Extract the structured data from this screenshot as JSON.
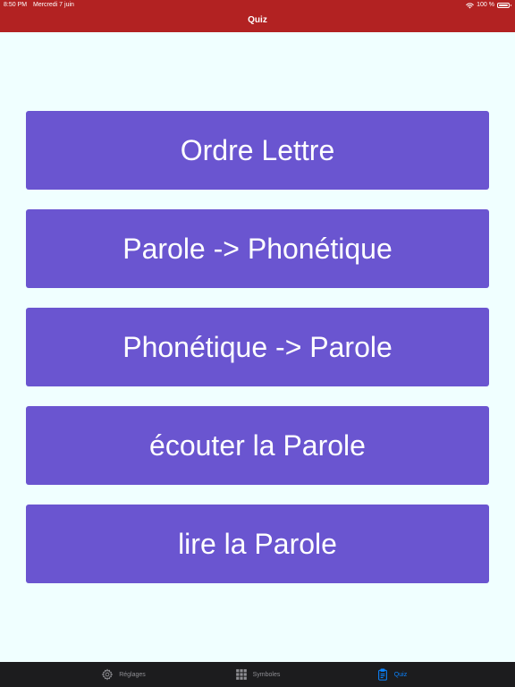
{
  "status_bar": {
    "time": "8:50 PM",
    "date": "Mercredi 7 juin",
    "battery": "100 %",
    "battery_level": 1.0
  },
  "header": {
    "title": "Quiz",
    "background_color": "#b22222"
  },
  "quiz_buttons": [
    {
      "label": "Ordre Lettre"
    },
    {
      "label": "Parole -> Phonétique"
    },
    {
      "label": "Phonétique -> Parole"
    },
    {
      "label": "écouter la Parole"
    },
    {
      "label": "lire la Parole"
    }
  ],
  "button_color": "#6a55d0",
  "tab_bar": {
    "items": [
      {
        "label": "Réglages",
        "icon": "gear-icon",
        "active": false
      },
      {
        "label": "Symboles",
        "icon": "grid-icon",
        "active": false
      },
      {
        "label": "Quiz",
        "icon": "clipboard-icon",
        "active": true
      }
    ],
    "active_color": "#0a84ff"
  }
}
